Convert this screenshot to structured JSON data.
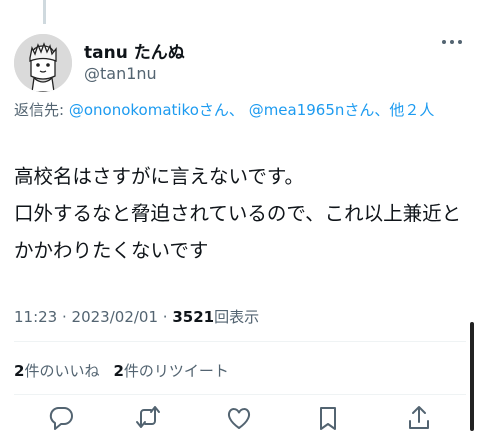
{
  "tweet": {
    "author_name": "tanu たんぬ",
    "author_handle": "@tan1nu",
    "reply_label": "返信先: ",
    "reply_users": [
      "@ononokomatiko",
      "@mea1965n"
    ],
    "reply_san": "さん、",
    "reply_others": "他２人",
    "text": "高校名はさすがに言えないです。\n口外するなと脅迫されているので、これ以上兼近とかかわりたくないです",
    "time": "11:23",
    "date": "2023/02/01",
    "views_count": "3521",
    "views_label": "回表示",
    "likes_count": "2",
    "likes_label": "件のいいね",
    "retweets_count": "2",
    "retweets_label": "件のリツイート"
  },
  "icons": {
    "more": "more-icon",
    "reply": "reply-icon",
    "retweet": "retweet-icon",
    "like": "like-icon",
    "bookmark": "bookmark-icon",
    "share": "share-icon"
  },
  "colors": {
    "link": "#1d9bf0",
    "secondary_text": "#536471",
    "primary_text": "#0f1419"
  }
}
